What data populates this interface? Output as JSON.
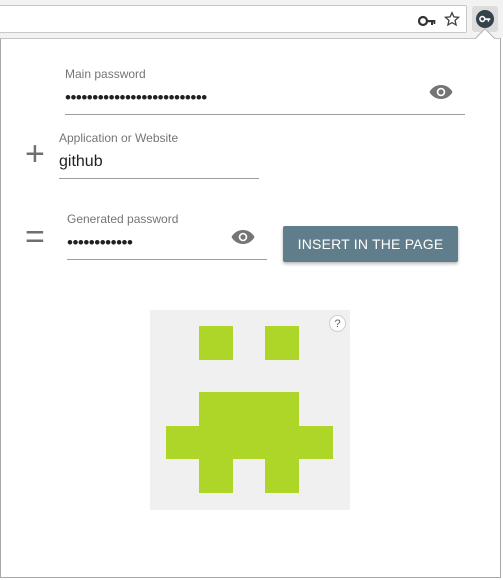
{
  "browser": {
    "key_icon": "key-icon",
    "star_icon": "star-icon",
    "extension_icon": "lesspass-extension-icon"
  },
  "form": {
    "main_password": {
      "label": "Main password",
      "value": "••••••••••••••••••••••••••",
      "toggle_icon": "eye-icon"
    },
    "site": {
      "operator": "+",
      "label": "Application or Website",
      "value": "github"
    },
    "generated": {
      "operator": "=",
      "label": "Generated password",
      "value": "••••••••••••",
      "toggle_icon": "eye-icon"
    },
    "insert_button_label": "INSERT IN THE PAGE"
  },
  "identicon": {
    "color": "#add629",
    "background": "#f0f0f0",
    "help_label": "?"
  },
  "colors": {
    "button": "#607d8b",
    "operator": "#6f6f6f"
  }
}
